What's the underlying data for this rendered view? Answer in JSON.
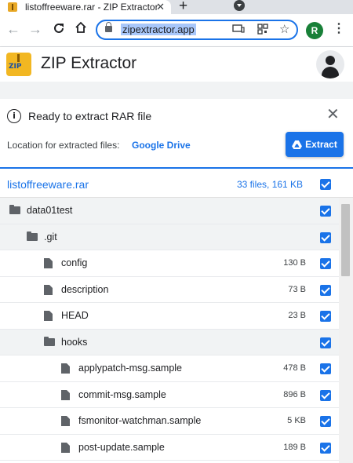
{
  "browser": {
    "tab_title": "listoffreeware.rar - ZIP Extractor",
    "tab_close": "✕",
    "new_tab": "+",
    "url": "zipextractor.app",
    "profile_initial": "R",
    "icons": [
      "back-icon",
      "forward-icon",
      "reload-icon",
      "home-icon",
      "lock-icon",
      "cast-icon",
      "qr-code-icon",
      "star-icon",
      "more-icon"
    ]
  },
  "app": {
    "title": "ZIP Extractor",
    "logo_text": "ZIP"
  },
  "banner": {
    "title": "Ready to extract RAR file",
    "location_label": "Location for extracted files:",
    "location_link": "Google Drive",
    "extract_label": "Extract"
  },
  "archive": {
    "name": "listoffreeware.rar",
    "info": "33 files, 161 KB"
  },
  "rows": [
    {
      "name": "data01test",
      "type": "folder",
      "size": "",
      "depth": 0
    },
    {
      "name": ".git",
      "type": "folder",
      "size": "",
      "depth": 1
    },
    {
      "name": "config",
      "type": "file",
      "size": "130 B",
      "depth": 2
    },
    {
      "name": "description",
      "type": "file",
      "size": "73 B",
      "depth": 2
    },
    {
      "name": "HEAD",
      "type": "file",
      "size": "23 B",
      "depth": 2
    },
    {
      "name": "hooks",
      "type": "folder",
      "size": "",
      "depth": 2
    },
    {
      "name": "applypatch-msg.sample",
      "type": "file",
      "size": "478 B",
      "depth": 3
    },
    {
      "name": "commit-msg.sample",
      "type": "file",
      "size": "896 B",
      "depth": 3
    },
    {
      "name": "fsmonitor-watchman.sample",
      "type": "file",
      "size": "5 KB",
      "depth": 3
    },
    {
      "name": "post-update.sample",
      "type": "file",
      "size": "189 B",
      "depth": 3
    }
  ],
  "colors": {
    "accent": "#1a73e8",
    "folder_row_bg": "#f1f3f4",
    "icon_gray": "#5f6368"
  }
}
